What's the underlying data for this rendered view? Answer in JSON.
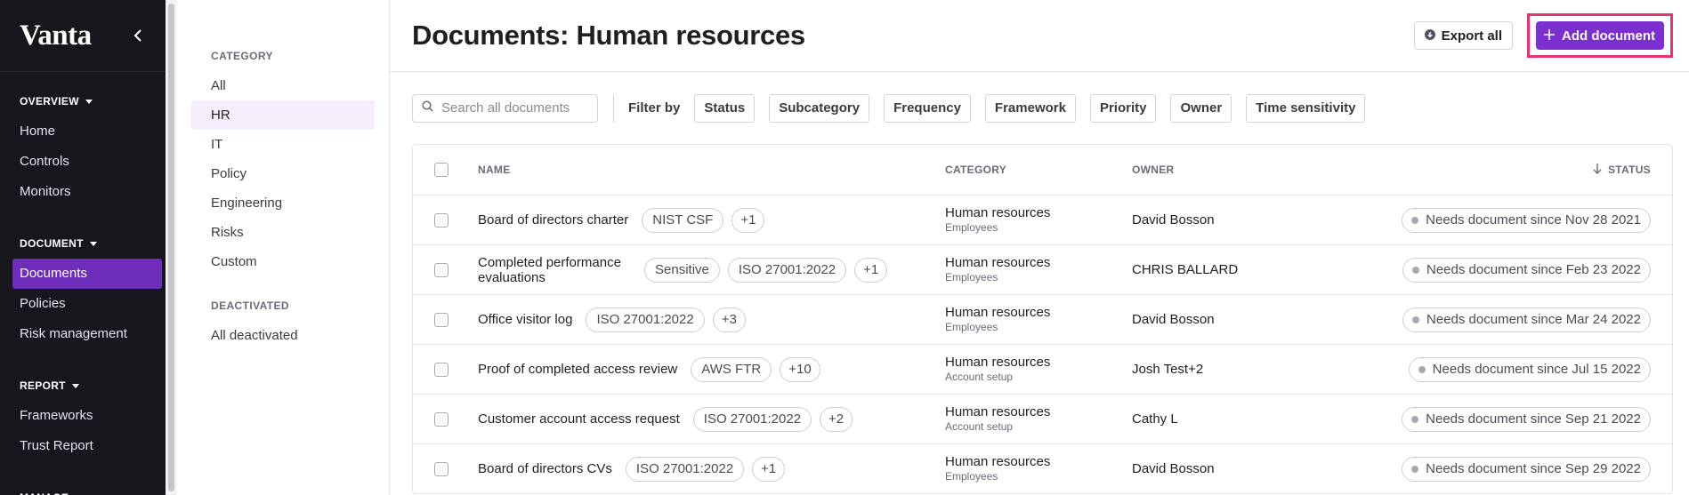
{
  "nav": {
    "logo": "Vanta",
    "groups": [
      {
        "heading": "OVERVIEW",
        "items": [
          {
            "label": "Home"
          },
          {
            "label": "Controls"
          },
          {
            "label": "Monitors"
          }
        ]
      },
      {
        "heading": "DOCUMENT",
        "items": [
          {
            "label": "Documents",
            "active": true
          },
          {
            "label": "Policies"
          },
          {
            "label": "Risk management"
          }
        ]
      },
      {
        "heading": "REPORT",
        "items": [
          {
            "label": "Frameworks"
          },
          {
            "label": "Trust Report"
          }
        ]
      },
      {
        "heading": "MANAGE",
        "items": []
      }
    ]
  },
  "categories": {
    "heading": "CATEGORY",
    "items": [
      "All",
      "HR",
      "IT",
      "Policy",
      "Engineering",
      "Risks",
      "Custom"
    ],
    "active": "HR",
    "deactivated_heading": "DEACTIVATED",
    "deactivated_items": [
      "All deactivated"
    ]
  },
  "header": {
    "title": "Documents: Human resources",
    "export_label": "Export all",
    "add_label": "Add document"
  },
  "filters": {
    "search_placeholder": "Search all documents",
    "filter_by_label": "Filter by",
    "chips": [
      "Status",
      "Subcategory",
      "Frequency",
      "Framework",
      "Priority",
      "Owner",
      "Time sensitivity"
    ]
  },
  "table": {
    "columns": {
      "name": "NAME",
      "category": "CATEGORY",
      "owner": "OWNER",
      "status": "STATUS"
    },
    "rows": [
      {
        "name": "Board of directors charter",
        "tags": [
          "NIST CSF",
          "+1"
        ],
        "category": "Human resources",
        "subcategory": "Employees",
        "owner": "David Bosson",
        "status": "Needs document since Nov 28 2021"
      },
      {
        "name": "Completed performance evaluations",
        "tags": [
          "Sensitive",
          "ISO 27001:2022",
          "+1"
        ],
        "category": "Human resources",
        "subcategory": "Employees",
        "owner": "CHRIS BALLARD",
        "status": "Needs document since Feb 23 2022"
      },
      {
        "name": "Office visitor log",
        "tags": [
          "ISO 27001:2022",
          "+3"
        ],
        "category": "Human resources",
        "subcategory": "Employees",
        "owner": "David Bosson",
        "status": "Needs document since Mar 24 2022"
      },
      {
        "name": "Proof of completed access review",
        "tags": [
          "AWS FTR",
          "+10"
        ],
        "category": "Human resources",
        "subcategory": "Account setup",
        "owner": "Josh Test+2",
        "status": "Needs document since Jul 15 2022"
      },
      {
        "name": "Customer account access request",
        "tags": [
          "ISO 27001:2022",
          "+2"
        ],
        "category": "Human resources",
        "subcategory": "Account setup",
        "owner": "Cathy L",
        "status": "Needs document since Sep 21 2022"
      },
      {
        "name": "Board of directors CVs",
        "tags": [
          "ISO 27001:2022",
          "+1"
        ],
        "category": "Human resources",
        "subcategory": "Employees",
        "owner": "David Bosson",
        "status": "Needs document since Sep 29 2022"
      }
    ]
  },
  "colors": {
    "accent": "#7b2fd0",
    "nav_bg": "#17161c",
    "highlight": "#e7336f"
  }
}
